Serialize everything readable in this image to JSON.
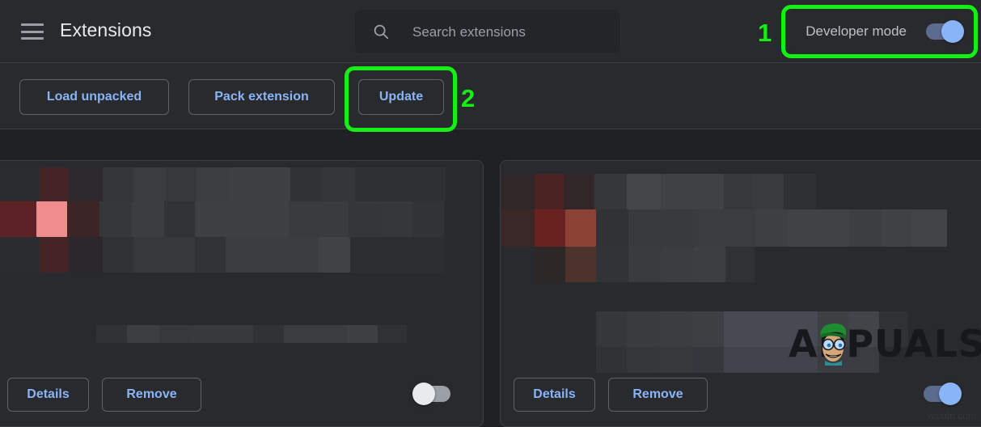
{
  "window": {
    "background": "#202124",
    "surface": "#292a2d"
  },
  "header": {
    "menu_icon": "hamburger-menu-icon",
    "title": "Extensions",
    "search": {
      "icon": "search-icon",
      "placeholder": "Search extensions",
      "value": ""
    },
    "developer_mode": {
      "label": "Developer mode",
      "state": "on",
      "toggle_color": "#8ab4f8"
    }
  },
  "toolbar": {
    "buttons": [
      {
        "id": "load-unpacked",
        "label": "Load unpacked"
      },
      {
        "id": "pack-extension",
        "label": "Pack extension"
      },
      {
        "id": "update",
        "label": "Update"
      }
    ]
  },
  "annotations": {
    "color": "#14f014",
    "items": [
      {
        "number": "1",
        "target": "developer-mode-toggle"
      },
      {
        "number": "2",
        "target": "update-button"
      }
    ]
  },
  "extensions": [
    {
      "name_censored": true,
      "details_label": "Details",
      "remove_label": "Remove",
      "enabled": false,
      "toggle_state": "off"
    },
    {
      "name_censored": true,
      "details_label": "Details",
      "remove_label": "Remove",
      "enabled": true,
      "toggle_state": "on"
    }
  ],
  "watermarks": {
    "brand": "APPUALS",
    "site": "wsxdn.com"
  }
}
